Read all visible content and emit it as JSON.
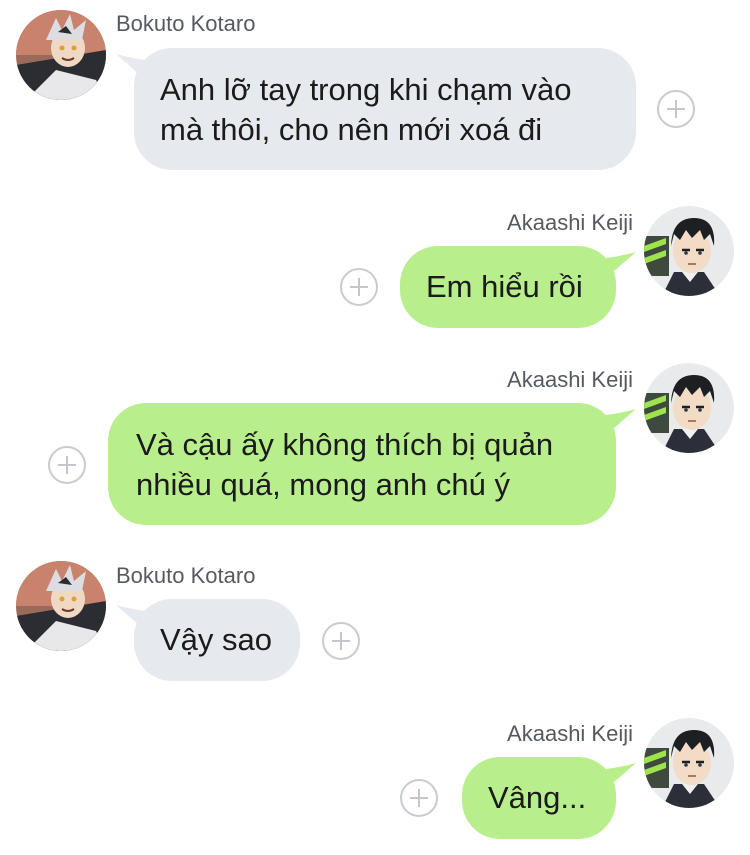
{
  "chat": {
    "messages": [
      {
        "sender": "Bokuto Kotaro",
        "direction": "in",
        "lines": [
          "Anh lỡ tay trong khi chạm vào",
          "mà thôi, cho nên mới xoá đi"
        ]
      },
      {
        "sender": "Akaashi Keiji",
        "direction": "out",
        "lines": [
          "Em hiểu rồi"
        ]
      },
      {
        "sender": "Akaashi Keiji",
        "direction": "out",
        "lines": [
          "Và cậu ấy không thích bị quản",
          "nhiều quá, mong anh chú ý"
        ]
      },
      {
        "sender": "Bokuto Kotaro",
        "direction": "in",
        "lines": [
          "Vậy sao"
        ]
      },
      {
        "sender": "Akaashi Keiji",
        "direction": "out",
        "lines": [
          "Vâng..."
        ]
      }
    ]
  },
  "icons": {
    "add": "plus-circle-icon"
  },
  "colors": {
    "incoming_bubble": "#e6e9ed",
    "outgoing_bubble": "#b9ee8c",
    "sender_name": "#555a60",
    "add_icon": "#c8cbcf"
  }
}
